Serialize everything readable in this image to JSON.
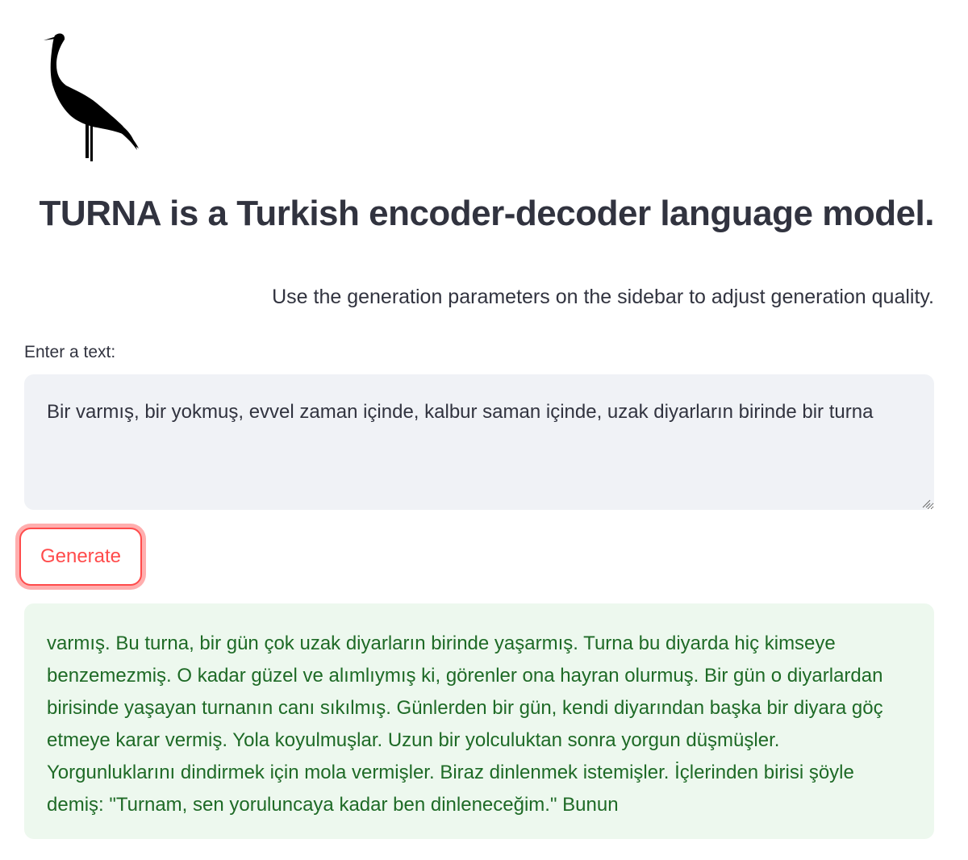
{
  "logo": {
    "icon": "crane-silhouette-icon"
  },
  "header": {
    "title": "TURNA is a Turkish encoder-decoder language model.",
    "subtitle": "Use the generation parameters on the sidebar to adjust generation quality."
  },
  "input": {
    "label": "Enter a text:",
    "value": "Bir varmış, bir yokmuş, evvel zaman içinde, kalbur saman içinde, uzak diyarların birinde bir turna"
  },
  "button": {
    "generate_label": "Generate"
  },
  "output": {
    "text": "varmış. Bu turna, bir gün çok uzak diyarların birinde yaşarmış. Turna bu diyarda hiç kimseye benzemezmiş. O kadar güzel ve alımlıymış ki, görenler ona hayran olurmuş. Bir gün o diyarlardan birisinde yaşayan turnanın canı sıkılmış. Günlerden bir gün, kendi diyarından başka bir diyara göç etmeye karar vermiş. Yola koyulmuşlar. Uzun bir yolculuktan sonra yorgun düşmüşler. Yorgunluklarını dindirmek için mola vermişler. Biraz dinlenmek istemişler. İçlerinden birisi şöyle demiş: \"Turnam, sen yoruluncaya kadar ben dinleneceğim.\" Bunun"
  },
  "colors": {
    "accent": "#ff4b4b",
    "output_text": "#1e6a26",
    "output_background": "#edf8ee",
    "input_background": "#f0f2f6"
  }
}
